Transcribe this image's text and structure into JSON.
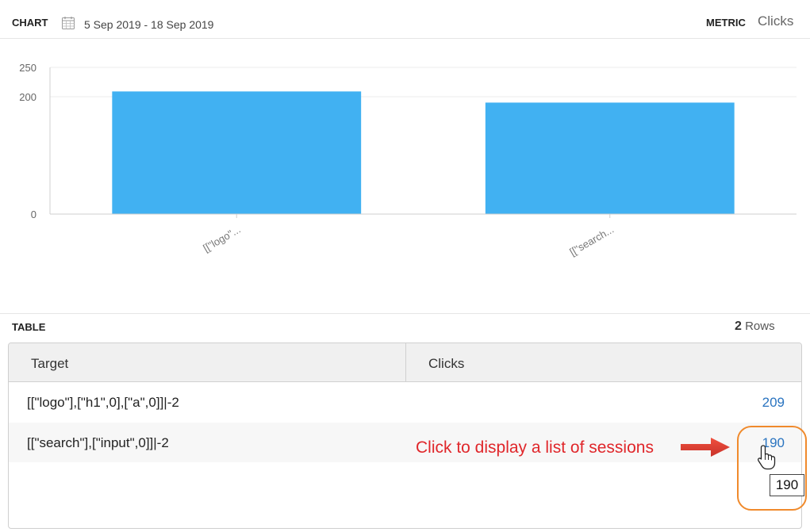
{
  "header": {
    "chart_label": "CHART",
    "date_range": "5 Sep 2019 - 18 Sep 2019",
    "metric_label": "METRIC",
    "metric_value": "Clicks"
  },
  "chart_data": {
    "type": "bar",
    "categories": [
      "[[\"logo\"...",
      "[[\"search..."
    ],
    "values": [
      209,
      190
    ],
    "yticks": [
      0,
      200,
      250
    ],
    "ylim": [
      0,
      250
    ],
    "grid": true,
    "colors": [
      "#41b1f2"
    ]
  },
  "table": {
    "title": "TABLE",
    "rows_count": "2",
    "rows_label": "Rows",
    "columns": [
      "Target",
      "Clicks"
    ],
    "rows": [
      {
        "target": "[[\"logo\"],[\"h1\",0],[\"a\",0]]|-2",
        "clicks": "209"
      },
      {
        "target": "[[\"search\"],[\"input\",0]]|-2",
        "clicks": "190"
      }
    ]
  },
  "annotation": {
    "text": "Click to display a list of sessions",
    "tooltip": "190",
    "color": "#e0262a",
    "highlight_color": "#f08a2c"
  }
}
